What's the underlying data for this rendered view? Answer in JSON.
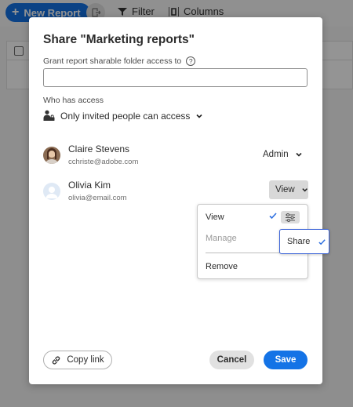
{
  "toolbar": {
    "new_report_label": "New Report",
    "filter_label": "Filter",
    "columns_label": "Columns"
  },
  "dialog": {
    "title": "Share \"Marketing reports\"",
    "grant_label": "Grant report sharable folder access to",
    "access_input_value": "",
    "who_label": "Who has access",
    "access_mode": "Only invited people can access",
    "people": [
      {
        "name": "Claire Stevens",
        "email": "cchriste@adobe.com",
        "role": "Admin"
      },
      {
        "name": "Olivia Kim",
        "email": "olivia@email.com",
        "role": "View"
      }
    ],
    "role_menu": {
      "view": "View",
      "manage": "Manage",
      "remove": "Remove",
      "submenu_share": "Share"
    },
    "copy_link_label": "Copy link",
    "cancel_label": "Cancel",
    "save_label": "Save"
  },
  "colors": {
    "accent": "#1473e6",
    "submenu_border": "#3b63d8",
    "overlay": "rgba(0,0,0,0.42)"
  },
  "icons": [
    "plus-icon",
    "export-icon",
    "filter-icon",
    "columns-icon",
    "help-icon",
    "lock-people-icon",
    "chevron-down-icon",
    "checkmark-icon",
    "settings-sliders-icon",
    "link-icon"
  ]
}
